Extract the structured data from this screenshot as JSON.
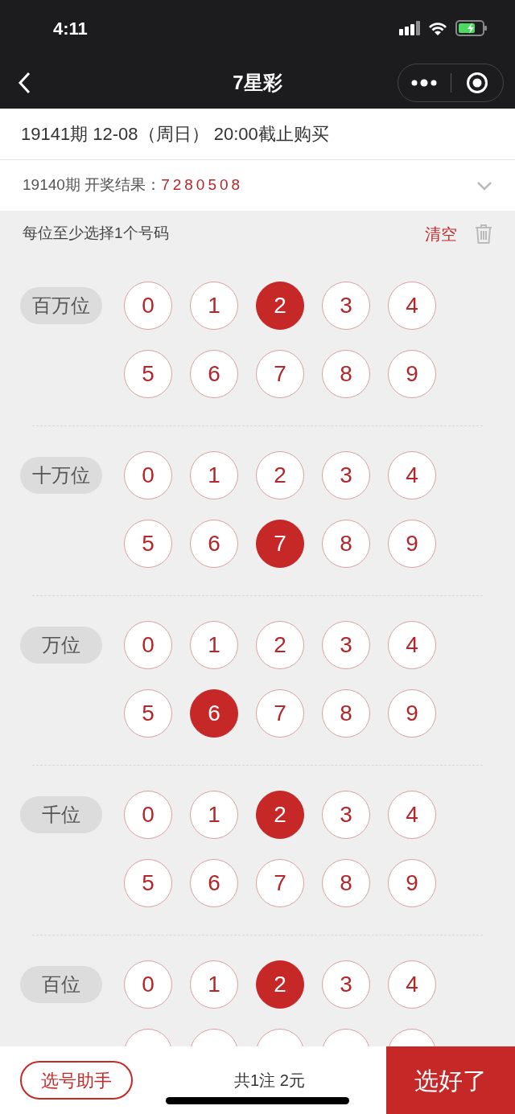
{
  "status_bar": {
    "time": "4:11"
  },
  "nav": {
    "title": "7星彩"
  },
  "draw_info": "19141期 12-08（周日） 20:00截止购买",
  "last_result": {
    "label": "19140期 开奖结果：",
    "numbers": "7280508",
    "expanded": false
  },
  "hint": {
    "text": "每位至少选择1个号码",
    "clear": "清空"
  },
  "sections": [
    {
      "label": "百万位",
      "rows": [
        [
          {
            "digit": "0",
            "selected": false
          },
          {
            "digit": "1",
            "selected": false
          },
          {
            "digit": "2",
            "selected": true
          },
          {
            "digit": "3",
            "selected": false
          },
          {
            "digit": "4",
            "selected": false
          }
        ],
        [
          {
            "digit": "5",
            "selected": false
          },
          {
            "digit": "6",
            "selected": false
          },
          {
            "digit": "7",
            "selected": false
          },
          {
            "digit": "8",
            "selected": false
          },
          {
            "digit": "9",
            "selected": false
          }
        ]
      ]
    },
    {
      "label": "十万位",
      "rows": [
        [
          {
            "digit": "0",
            "selected": false
          },
          {
            "digit": "1",
            "selected": false
          },
          {
            "digit": "2",
            "selected": false
          },
          {
            "digit": "3",
            "selected": false
          },
          {
            "digit": "4",
            "selected": false
          }
        ],
        [
          {
            "digit": "5",
            "selected": false
          },
          {
            "digit": "6",
            "selected": false
          },
          {
            "digit": "7",
            "selected": true
          },
          {
            "digit": "8",
            "selected": false
          },
          {
            "digit": "9",
            "selected": false
          }
        ]
      ]
    },
    {
      "label": "万位",
      "rows": [
        [
          {
            "digit": "0",
            "selected": false
          },
          {
            "digit": "1",
            "selected": false
          },
          {
            "digit": "2",
            "selected": false
          },
          {
            "digit": "3",
            "selected": false
          },
          {
            "digit": "4",
            "selected": false
          }
        ],
        [
          {
            "digit": "5",
            "selected": false
          },
          {
            "digit": "6",
            "selected": true
          },
          {
            "digit": "7",
            "selected": false
          },
          {
            "digit": "8",
            "selected": false
          },
          {
            "digit": "9",
            "selected": false
          }
        ]
      ]
    },
    {
      "label": "千位",
      "rows": [
        [
          {
            "digit": "0",
            "selected": false
          },
          {
            "digit": "1",
            "selected": false
          },
          {
            "digit": "2",
            "selected": true
          },
          {
            "digit": "3",
            "selected": false
          },
          {
            "digit": "4",
            "selected": false
          }
        ],
        [
          {
            "digit": "5",
            "selected": false
          },
          {
            "digit": "6",
            "selected": false
          },
          {
            "digit": "7",
            "selected": false
          },
          {
            "digit": "8",
            "selected": false
          },
          {
            "digit": "9",
            "selected": false
          }
        ]
      ]
    },
    {
      "label": "百位",
      "rows": [
        [
          {
            "digit": "0",
            "selected": false
          },
          {
            "digit": "1",
            "selected": false
          },
          {
            "digit": "2",
            "selected": true
          },
          {
            "digit": "3",
            "selected": false
          },
          {
            "digit": "4",
            "selected": false
          }
        ]
      ],
      "cut_row": true
    }
  ],
  "bottom_bar": {
    "helper": "选号助手",
    "summary": "共1注 2元",
    "confirm": "选好了"
  }
}
